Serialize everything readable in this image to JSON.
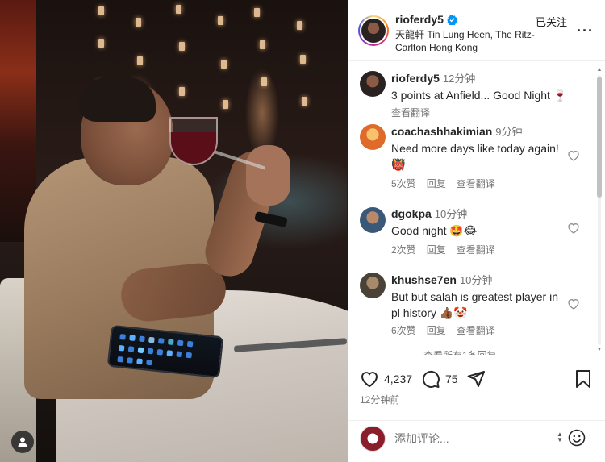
{
  "post": {
    "username": "rioferdy5",
    "follow_status": "已关注",
    "location": "天龍軒 Tin Lung Heen, The Ritz-Carlton Hong Kong",
    "more_icon": "more-horizontal-icon"
  },
  "caption": {
    "username": "rioferdy5",
    "time": "12分钟",
    "text": "3 points at Anfield... Good Night 🍷",
    "translate": "查看翻译"
  },
  "comments": [
    {
      "username": "coachashhakimian",
      "time": "9分钟",
      "text": "Need more days like today again! 👹",
      "likes": "5次赞",
      "reply": "回复",
      "translate": "查看翻译"
    },
    {
      "username": "dgokpa",
      "time": "10分钟",
      "text": "Good night 🤩😂",
      "likes": "2次赞",
      "reply": "回复",
      "translate": "查看翻译"
    },
    {
      "username": "khushse7en",
      "time": "10分钟",
      "text": "But but salah is greatest player in pl history 👍🏾🤡",
      "likes": "6次赞",
      "reply": "回复",
      "translate": "查看翻译"
    }
  ],
  "view_replies": "查看所有1条回复",
  "actions": {
    "likes": "4,237",
    "comments": "75",
    "timestamp": "12分钟前"
  },
  "composer": {
    "placeholder": "添加评论..."
  },
  "colors": {
    "accent": "#0095f6",
    "muted": "#737373",
    "text": "#262626"
  }
}
